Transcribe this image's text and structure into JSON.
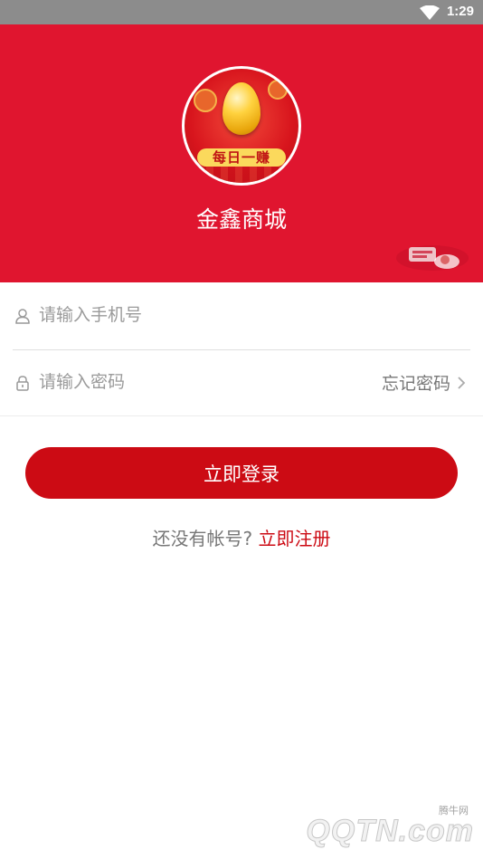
{
  "status_bar": {
    "time": "1:29",
    "wifi_icon": "wifi-icon"
  },
  "header": {
    "background_color": "#e0152f",
    "logo": {
      "banner_text": "每日一赚",
      "egg_icon": "golden-egg-icon"
    },
    "app_title": "金鑫商城"
  },
  "form": {
    "phone": {
      "icon": "user-icon",
      "placeholder": "请输入手机号",
      "value": ""
    },
    "password": {
      "icon": "lock-icon",
      "placeholder": "请输入密码",
      "value": "",
      "forgot_label": "忘记密码",
      "forgot_icon": "chevron-right-icon"
    }
  },
  "login_button": {
    "label": "立即登录",
    "color": "#cc0b14"
  },
  "register": {
    "question": "还没有帐号?",
    "link_label": "立即注册"
  },
  "watermark": {
    "small": "腾牛网",
    "big": "QQTN.com"
  }
}
